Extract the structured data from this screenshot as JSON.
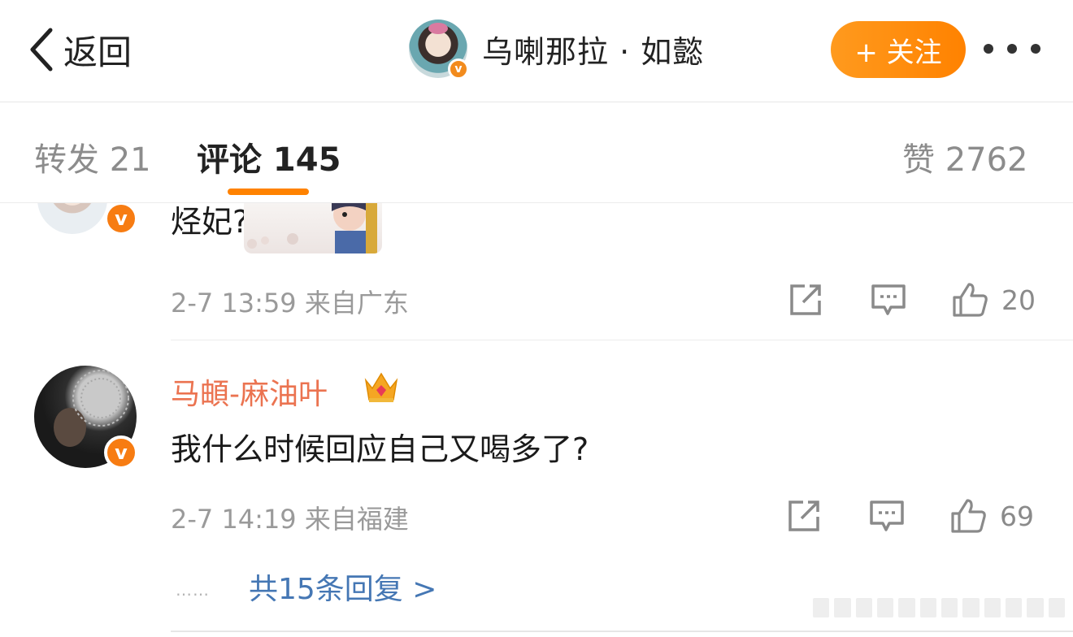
{
  "nav": {
    "back_label": "返回",
    "profile_name": "乌喇那拉 · 如懿",
    "follow_label": "+ 关注",
    "verified_mark": "v"
  },
  "tabs": [
    {
      "label": "转发 21"
    },
    {
      "label": "评论 145"
    },
    {
      "label": "赞 2762"
    }
  ],
  "comments": [
    {
      "text": "烃妃??",
      "verified_mark": "v",
      "meta": "2-7 13:59 来自广东",
      "likes": "20"
    },
    {
      "name": "马頔-麻油叶",
      "text": "我什么时候回应自己又喝多了?",
      "verified_mark": "v",
      "meta": "2-7 14:19 来自福建",
      "likes": "69",
      "replies_dots": "……",
      "replies_label": "共15条回复 >"
    }
  ],
  "colors": {
    "accent": "#ff8200",
    "name_orange": "#eb7350",
    "link_blue": "#4577b4"
  },
  "icons": [
    "back-chevron-icon",
    "verified-badge-icon",
    "more-dots-icon",
    "repost-icon",
    "comment-icon",
    "like-icon",
    "crown-icon"
  ]
}
